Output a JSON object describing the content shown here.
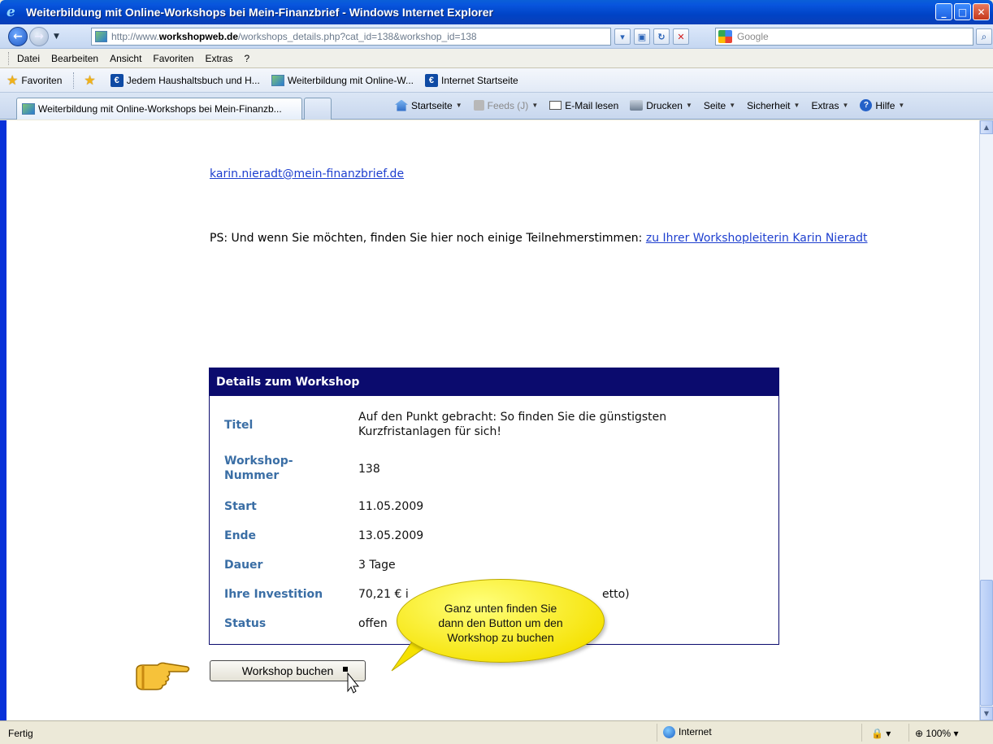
{
  "window": {
    "title": "Weiterbildung mit Online-Workshops bei Mein-Finanzbrief - Windows Internet Explorer"
  },
  "address": {
    "url_prefix": "http://www.",
    "url_host": "workshopweb.de",
    "url_path": "/workshops_details.php?cat_id=138&workshop_id=138",
    "search_placeholder": "Google"
  },
  "menu": {
    "items": [
      "Datei",
      "Bearbeiten",
      "Ansicht",
      "Favoriten",
      "Extras",
      "?"
    ]
  },
  "favorites": {
    "label": "Favoriten",
    "links": [
      "Jedem Haushaltsbuch und H...",
      "Weiterbildung mit Online-W...",
      "Internet Startseite"
    ]
  },
  "tabs": {
    "active": "Weiterbildung mit Online-Workshops bei Mein-Finanzb..."
  },
  "commandbar": {
    "home": "Startseite",
    "feeds": "Feeds (J)",
    "mail": "E-Mail lesen",
    "print": "Drucken",
    "page": "Seite",
    "safety": "Sicherheit",
    "tools": "Extras",
    "help": "Hilfe"
  },
  "content": {
    "email": "karin.nieradt@mein-finanzbrief.de",
    "ps_text": "PS: Und wenn Sie möchten, finden Sie hier noch einige Teilnehmerstimmen: ",
    "ps_link": "zu Ihrer Workshopleiterin Karin Nieradt"
  },
  "details": {
    "header": "Details zum Workshop",
    "rows": [
      {
        "label": "Titel",
        "value_line1": "Auf den Punkt gebracht: So finden Sie die günstigsten",
        "value_line2": "Kurzfristanlagen für sich!"
      },
      {
        "label_line1": "Workshop-",
        "label_line2": "Nummer",
        "value": "138"
      },
      {
        "label": "Start",
        "value": "11.05.2009"
      },
      {
        "label": "Ende",
        "value": "13.05.2009"
      },
      {
        "label": "Dauer",
        "value": "3 Tage"
      },
      {
        "label": "Ihre Investition",
        "value_start": "70,21 € i",
        "value_end": "etto)"
      },
      {
        "label": "Status",
        "value": "offen"
      }
    ]
  },
  "book_button": "Workshop buchen",
  "callout": {
    "line1": "Ganz unten finden Sie",
    "line2": "dann den Button um den",
    "line3": "Workshop zu buchen"
  },
  "status": {
    "text": "Fertig",
    "zone": "Internet",
    "zoom": "100%"
  },
  "colors": {
    "details_header_bg": "#0b0b6e",
    "label_color": "#3a6ea5",
    "callout_bg": "#f5e100",
    "link_color": "#1e3fcf"
  }
}
